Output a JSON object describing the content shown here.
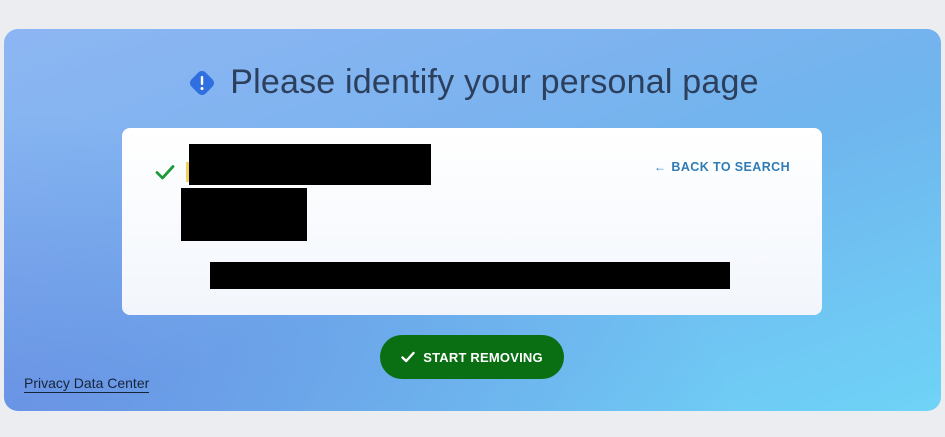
{
  "header": {
    "title": "Please identify your personal page",
    "icon": "alert-diamond-icon",
    "icon_color": "#2f6fe0"
  },
  "card": {
    "back_link_arrow": "←",
    "back_link_label": "BACK TO SEARCH",
    "selected_icon": "check-icon",
    "check_color": "#1f9a3a"
  },
  "actions": {
    "start_label": "START REMOVING",
    "start_icon": "check-icon",
    "start_color": "#0a6e12"
  },
  "footer": {
    "privacy_link": "Privacy Data Center"
  }
}
